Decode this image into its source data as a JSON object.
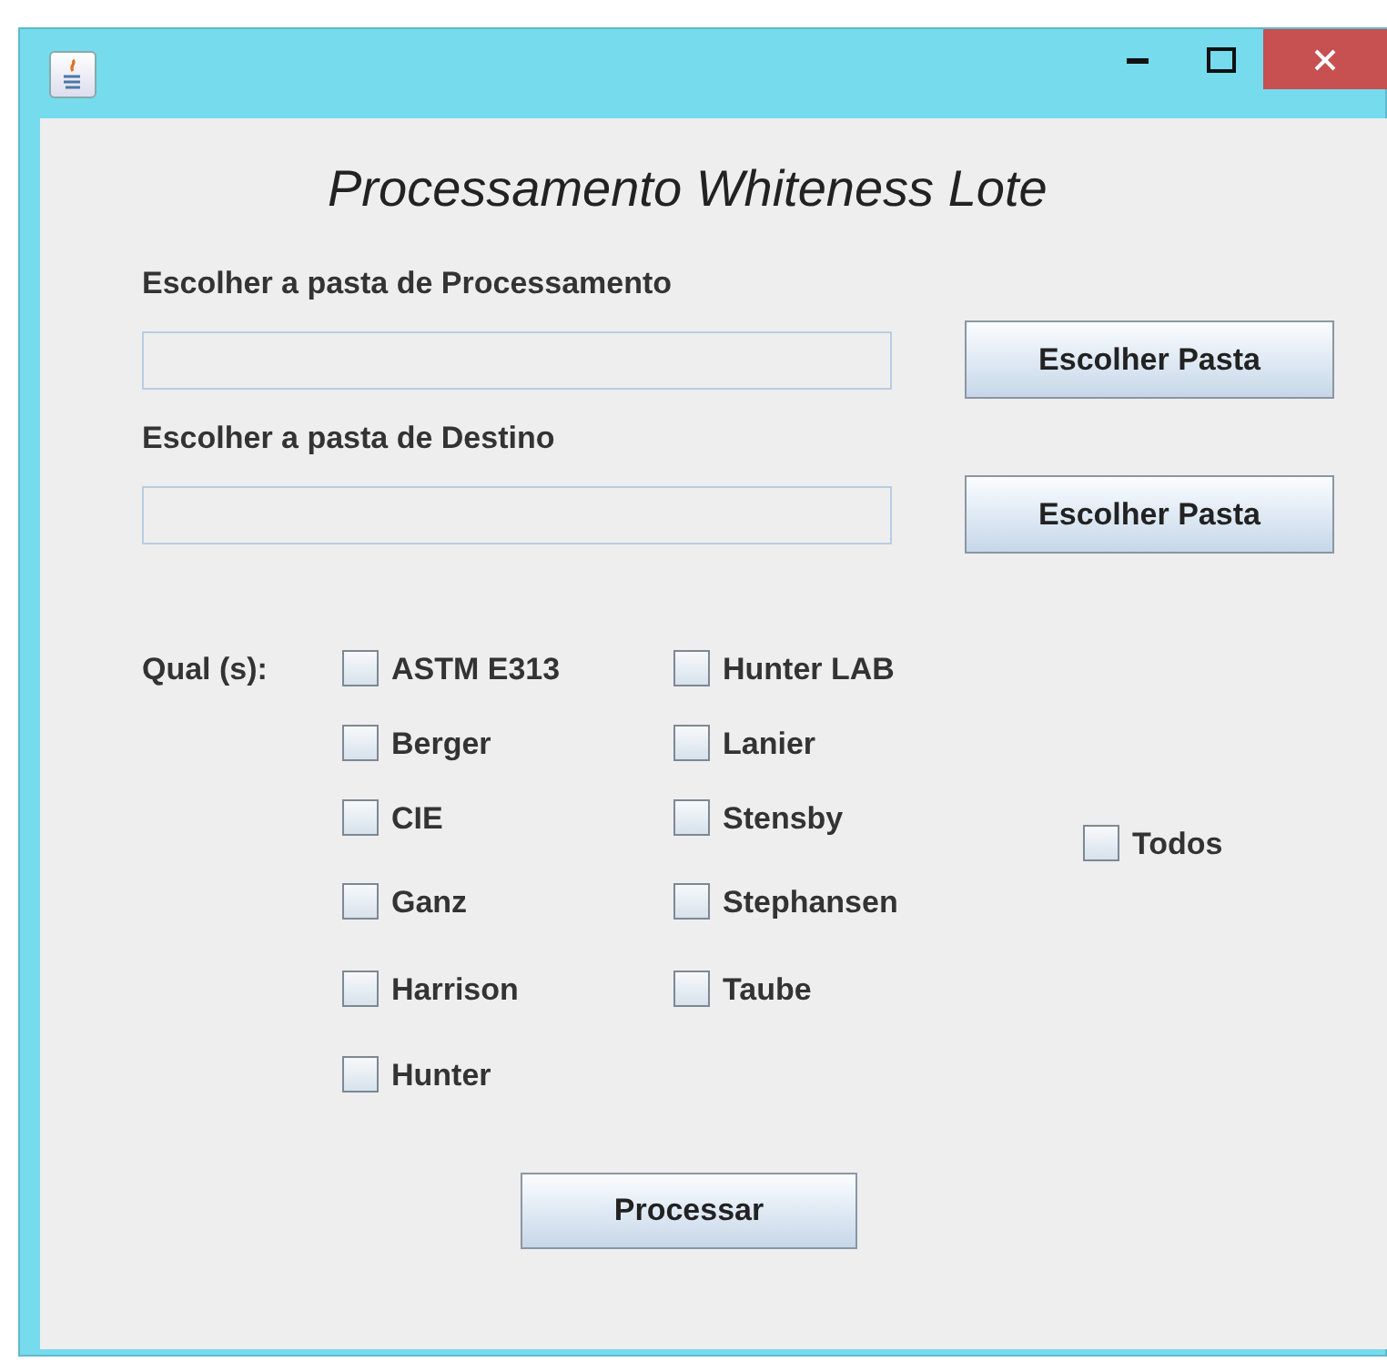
{
  "window": {
    "title": "Processamento Whiteness Lote"
  },
  "source": {
    "label": "Escolher a pasta de Processamento",
    "button": "Escolher Pasta"
  },
  "destination": {
    "label": "Escolher a pasta de Destino",
    "button": "Escolher Pasta"
  },
  "methods_label": "Qual (s):",
  "methods_column_1": [
    {
      "label": "ASTM E313",
      "checked": false
    },
    {
      "label": "Berger",
      "checked": false
    },
    {
      "label": "CIE",
      "checked": false
    },
    {
      "label": "Ganz",
      "checked": false
    },
    {
      "label": "Harrison",
      "checked": false
    },
    {
      "label": "Hunter",
      "checked": false
    }
  ],
  "methods_column_2": [
    {
      "label": "Hunter LAB",
      "checked": false
    },
    {
      "label": "Lanier",
      "checked": false
    },
    {
      "label": "Stensby",
      "checked": false
    },
    {
      "label": "Stephansen",
      "checked": false
    },
    {
      "label": "Taube",
      "checked": false
    }
  ],
  "all": {
    "label": "Todos",
    "checked": false
  },
  "submit": "Processar"
}
